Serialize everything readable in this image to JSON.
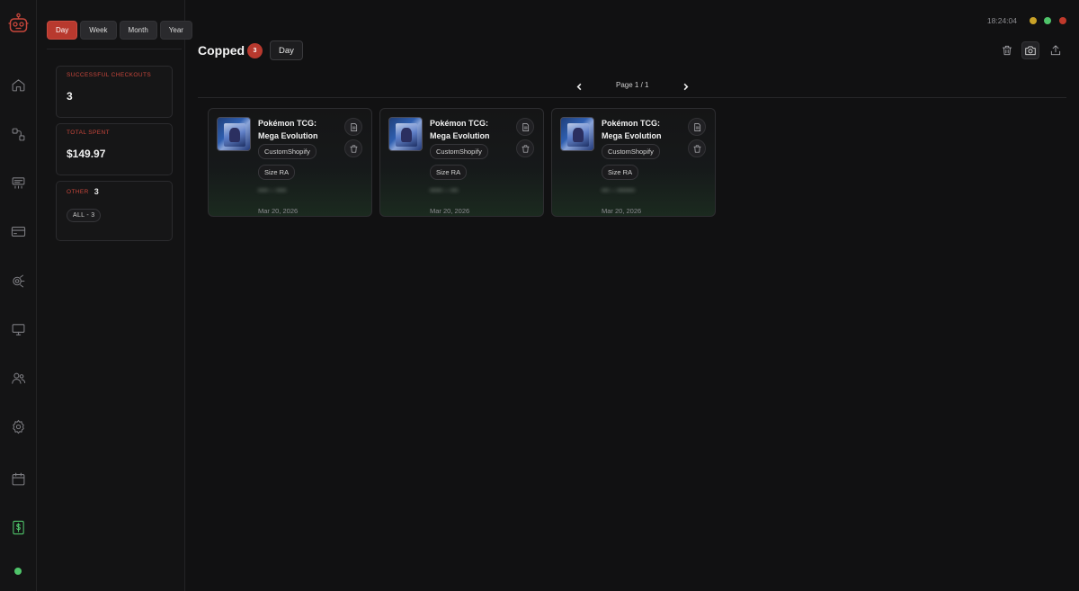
{
  "sidebar_nav": [
    {
      "name": "home-icon"
    },
    {
      "name": "flow-icon"
    },
    {
      "name": "tasks-icon"
    },
    {
      "name": "card-icon"
    },
    {
      "name": "proxy-icon"
    },
    {
      "name": "monitor-icon"
    },
    {
      "name": "users-icon"
    },
    {
      "name": "gear-icon"
    },
    {
      "name": "calendar-icon"
    },
    {
      "name": "dollar-icon",
      "active": true
    }
  ],
  "periods": [
    "Day",
    "Week",
    "Month",
    "Year"
  ],
  "active_period": "Day",
  "stats": {
    "checkouts_label": "SUCCESSFUL CHECKOUTS",
    "checkouts_value": "3",
    "spent_label": "TOTAL SPENT",
    "spent_value": "$149.97",
    "other_label": "OTHER",
    "other_count": "3",
    "all_chip": "ALL - 3"
  },
  "header": {
    "title": "Copped",
    "count": "3",
    "period": "Day",
    "clock": "18:24:04"
  },
  "window_controls": {
    "minimize": "#c9a227",
    "maximize": "#4fc46a",
    "close": "#c0392b"
  },
  "pager": {
    "label": "Page 1 / 1"
  },
  "cards": [
    {
      "title": "Pokémon TCG: Mega Evolution",
      "store": "CustomShopify",
      "size": "Size RA",
      "blurred": "•••• – ••••",
      "date": "Mar 20, 2026"
    },
    {
      "title": "Pokémon TCG: Mega Evolution",
      "store": "CustomShopify",
      "size": "Size RA",
      "blurred": "••••• – •••",
      "date": "Mar 20, 2026"
    },
    {
      "title": "Pokémon TCG: Mega Evolution",
      "store": "CustomShopify",
      "size": "Size RA",
      "blurred": "••• – •••••••",
      "date": "Mar 20, 2026"
    }
  ],
  "colors": {
    "accent": "#b8392e",
    "success": "#4fc46a",
    "background": "#111112"
  }
}
